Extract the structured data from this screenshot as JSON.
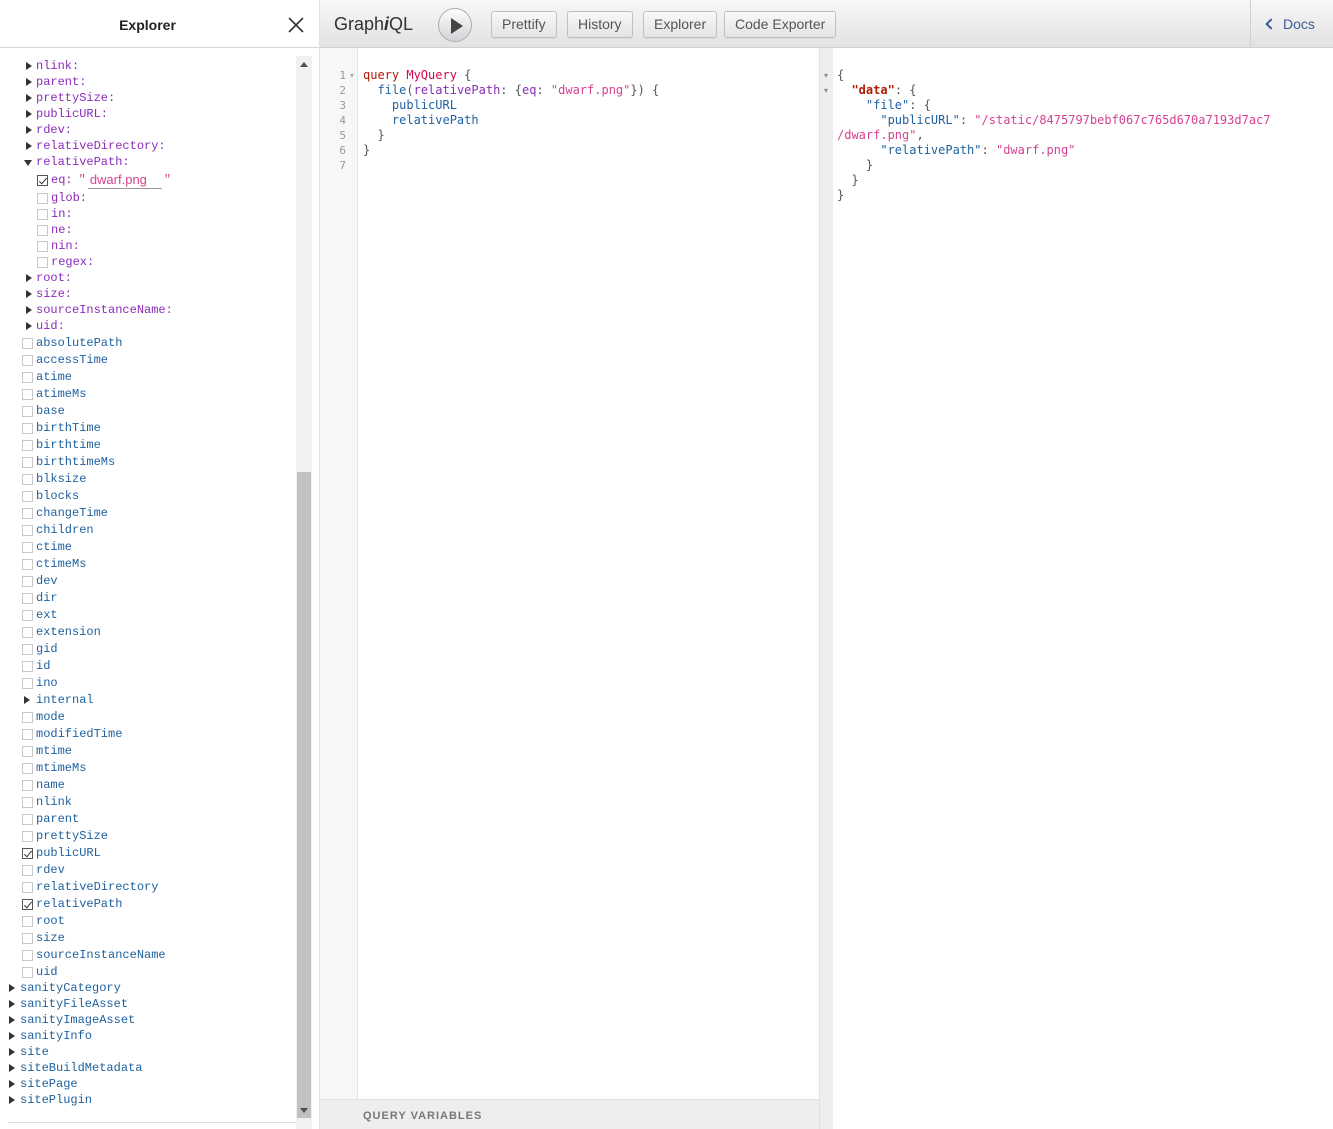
{
  "explorer": {
    "title": "Explorer",
    "eq_value": "dwarf.png",
    "args_top": [
      {
        "label": "nlink:"
      },
      {
        "label": "parent:"
      },
      {
        "label": "prettySize:"
      },
      {
        "label": "publicURL:"
      },
      {
        "label": "rdev:"
      },
      {
        "label": "relativeDirectory:"
      },
      {
        "label": "relativePath:"
      }
    ],
    "relpath_ops": {
      "eq": "eq:",
      "glob": "glob:",
      "in": "in:",
      "ne": "ne:",
      "nin": "nin:",
      "regex": "regex:"
    },
    "args_bottom": [
      {
        "label": "root:"
      },
      {
        "label": "size:"
      },
      {
        "label": "sourceInstanceName:"
      },
      {
        "label": "uid:"
      }
    ],
    "fields": [
      {
        "label": "absolutePath",
        "checked": false
      },
      {
        "label": "accessTime",
        "checked": false
      },
      {
        "label": "atime",
        "checked": false
      },
      {
        "label": "atimeMs",
        "checked": false
      },
      {
        "label": "base",
        "checked": false
      },
      {
        "label": "birthTime",
        "checked": false
      },
      {
        "label": "birthtime",
        "checked": false
      },
      {
        "label": "birthtimeMs",
        "checked": false
      },
      {
        "label": "blksize",
        "checked": false
      },
      {
        "label": "blocks",
        "checked": false
      },
      {
        "label": "changeTime",
        "checked": false
      },
      {
        "label": "children",
        "checked": false
      },
      {
        "label": "ctime",
        "checked": false
      },
      {
        "label": "ctimeMs",
        "checked": false
      },
      {
        "label": "dev",
        "checked": false
      },
      {
        "label": "dir",
        "checked": false
      },
      {
        "label": "ext",
        "checked": false
      },
      {
        "label": "extension",
        "checked": false
      },
      {
        "label": "gid",
        "checked": false
      },
      {
        "label": "id",
        "checked": false
      },
      {
        "label": "ino",
        "checked": false
      },
      {
        "label": "internal",
        "expandable": true
      },
      {
        "label": "mode",
        "checked": false
      },
      {
        "label": "modifiedTime",
        "checked": false
      },
      {
        "label": "mtime",
        "checked": false
      },
      {
        "label": "mtimeMs",
        "checked": false
      },
      {
        "label": "name",
        "checked": false
      },
      {
        "label": "nlink",
        "checked": false
      },
      {
        "label": "parent",
        "checked": false
      },
      {
        "label": "prettySize",
        "checked": false
      },
      {
        "label": "publicURL",
        "checked": true
      },
      {
        "label": "rdev",
        "checked": false
      },
      {
        "label": "relativeDirectory",
        "checked": false
      },
      {
        "label": "relativePath",
        "checked": true
      },
      {
        "label": "root",
        "checked": false
      },
      {
        "label": "size",
        "checked": false
      },
      {
        "label": "sourceInstanceName",
        "checked": false
      },
      {
        "label": "uid",
        "checked": false
      }
    ],
    "root_types": [
      {
        "label": "sanityCategory"
      },
      {
        "label": "sanityFileAsset"
      },
      {
        "label": "sanityImageAsset"
      },
      {
        "label": "sanityInfo"
      },
      {
        "label": "site"
      },
      {
        "label": "siteBuildMetadata"
      },
      {
        "label": "sitePage"
      },
      {
        "label": "sitePlugin"
      }
    ]
  },
  "toolbar": {
    "title_prefix": "Graph",
    "title_i": "i",
    "title_suffix": "QL",
    "prettify": "Prettify",
    "history": "History",
    "explorer": "Explorer",
    "code_exporter": "Code Exporter",
    "docs": "Docs"
  },
  "query": {
    "line_numbers": [
      "1",
      "2",
      "3",
      "4",
      "5",
      "6",
      "7"
    ],
    "kw_query": "query",
    "op_name": "MyQuery",
    "field_file": "file",
    "arg_relpath": "relativePath",
    "arg_eq": "eq",
    "string_val": "\"dwarf.png\"",
    "field_public_url": "publicURL",
    "field_relative_path": "relativePath"
  },
  "query_variables_label": "QUERY VARIABLES",
  "result": {
    "key_data": "\"data\"",
    "key_file": "\"file\"",
    "key_public_url": "\"publicURL\"",
    "public_url_part1": "\"/static/8475797bebf067c765d670a7193d7ac7",
    "public_url_part2": "/dwarf.png\"",
    "key_relative_path": "\"relativePath\"",
    "relative_path_value": "\"dwarf.png\""
  }
}
